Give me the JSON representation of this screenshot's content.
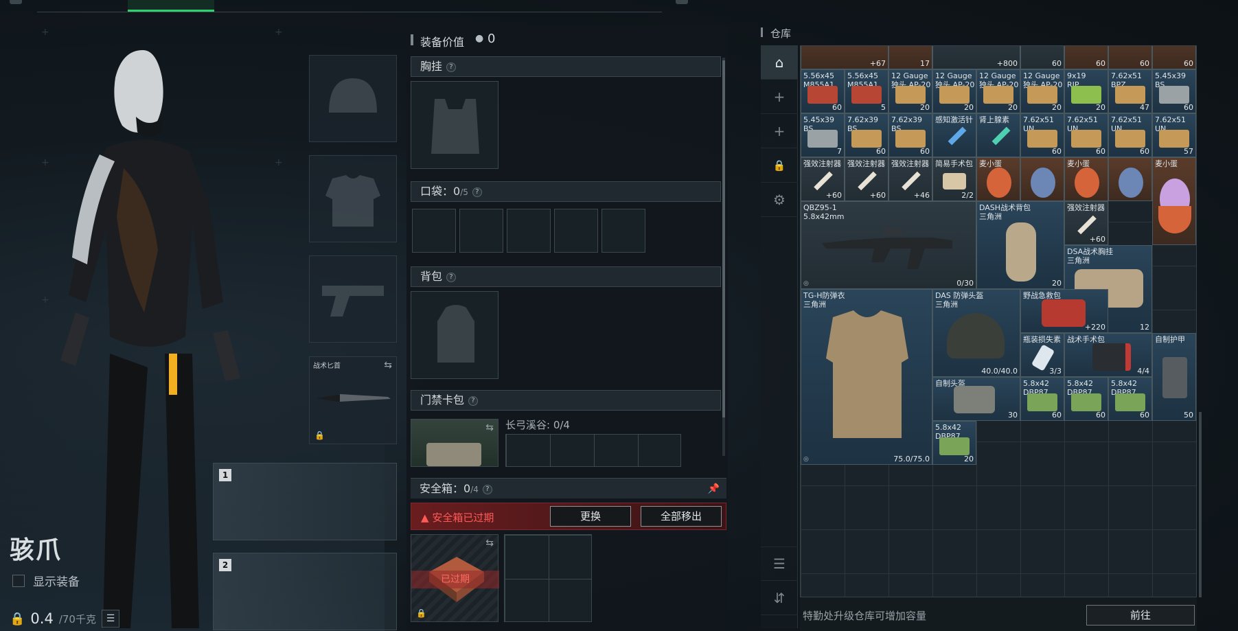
{
  "character": {
    "name": "骇爪",
    "show_equipment_label": "显示装备",
    "weight_current": "0.4",
    "weight_max": "/70千克"
  },
  "weapon_slots": [
    {
      "num": "1"
    },
    {
      "num": "2"
    }
  ],
  "gear": {
    "knife_label": "战术匕首"
  },
  "equipment": {
    "title": "装备价值",
    "value": "0",
    "chest_rig": "胸挂",
    "pocket_label": "口袋：",
    "pocket_count": "0",
    "pocket_max": "/5",
    "backpack": "背包",
    "keycard": "门禁卡包",
    "keycard_area": "长弓溪谷: 0/4",
    "safe_label": "安全箱：",
    "safe_count": "0",
    "safe_max": "/4",
    "safe_expired": "安全箱已过期",
    "replace_btn": "更换",
    "remove_all_btn": "全部移出",
    "expired_tag": "已过期",
    "help": "?"
  },
  "warehouse": {
    "title": "仓库",
    "footer_hint": "特勤处升级仓库可增加容量",
    "go_btn": "前往",
    "colors": {
      "accent_green": "#2fd16c",
      "warning_red": "#ff5a56"
    },
    "sidebar_icons": [
      "home-icon",
      "plus-icon",
      "plus-icon",
      "lock-icon",
      "gear-icon",
      "layers-icon",
      "sort-icon"
    ],
    "items": [
      {
        "name": "",
        "count": "67",
        "pre": "+"
      },
      {
        "name": "",
        "count": "17",
        "pre": ""
      },
      {
        "name": "",
        "count": "800",
        "pre": "+"
      },
      {
        "name": "",
        "count": "60",
        "pre": ""
      },
      {
        "name": "",
        "count": "60",
        "pre": ""
      },
      {
        "name": "",
        "count": "60",
        "pre": ""
      },
      {
        "name": "",
        "count": "60",
        "pre": ""
      },
      {
        "name": "5.56x45\nM855A1",
        "count": "60"
      },
      {
        "name": "5.56x45\nM855A1",
        "count": "5"
      },
      {
        "name": "12 Gauge\n独头 AP-20",
        "count": "20"
      },
      {
        "name": "12 Gauge\n独头 AP-20",
        "count": "20"
      },
      {
        "name": "12 Gauge\n独头 AP-20",
        "count": "20"
      },
      {
        "name": "12 Gauge\n独头 AP-20",
        "count": "20"
      },
      {
        "name": "9x19\nRIP",
        "count": "20"
      },
      {
        "name": "7.62x51\nBPZ",
        "count": "47"
      },
      {
        "name": "5.45x39\nBS",
        "count": "60"
      },
      {
        "name": "5.45x39\nBS",
        "count": "7"
      },
      {
        "name": "7.62x39\nBS",
        "count": "60"
      },
      {
        "name": "7.62x39\nBS",
        "count": "60"
      },
      {
        "name": "感知激活针",
        "count": ""
      },
      {
        "name": "肾上腺素",
        "count": ""
      },
      {
        "name": "7.62x51\nUN",
        "count": "60"
      },
      {
        "name": "7.62x51\nUN",
        "count": "60"
      },
      {
        "name": "7.62x51\nUN",
        "count": "60"
      },
      {
        "name": "7.62x51\nUN",
        "count": "57"
      },
      {
        "name": "强效注射器",
        "count": "60",
        "pre": "+"
      },
      {
        "name": "强效注射器",
        "count": "60",
        "pre": "+"
      },
      {
        "name": "强效注射器",
        "count": "46",
        "pre": "+"
      },
      {
        "name": "简易手术包",
        "count": "2/2"
      },
      {
        "name": "麦小蛋",
        "count": ""
      },
      {
        "name": "麦小蛋",
        "count": ""
      },
      {
        "name": "麦小蛋",
        "count": ""
      },
      {
        "name": "QBZ95-1\n5.8x42mm",
        "count": "0/30"
      },
      {
        "name": "DASH战术背包\n三角洲",
        "count": "20"
      },
      {
        "name": "强效注射器",
        "count": "60",
        "pre": "+"
      },
      {
        "name": "DSA战术胸挂\n三角洲",
        "count": "12"
      },
      {
        "name": "TG-H防弹衣\n三角洲",
        "count": "75.0/75.0"
      },
      {
        "name": "DAS 防弹头盔\n三角洲",
        "count": "40.0/40.0"
      },
      {
        "name": "野战急救包",
        "count": "220",
        "pre": "+"
      },
      {
        "name": "瓶装损失素",
        "count": "3/3"
      },
      {
        "name": "战术手术包",
        "count": "4/4"
      },
      {
        "name": "自制护甲",
        "count": "50"
      },
      {
        "name": "自制头盔",
        "count": "30"
      },
      {
        "name": "5.8x42\nDBP87",
        "count": "60"
      },
      {
        "name": "5.8x42\nDBP87",
        "count": "60"
      },
      {
        "name": "5.8x42\nDBP87",
        "count": "60"
      },
      {
        "name": "5.8x42\nDBP87",
        "count": "20"
      }
    ]
  }
}
